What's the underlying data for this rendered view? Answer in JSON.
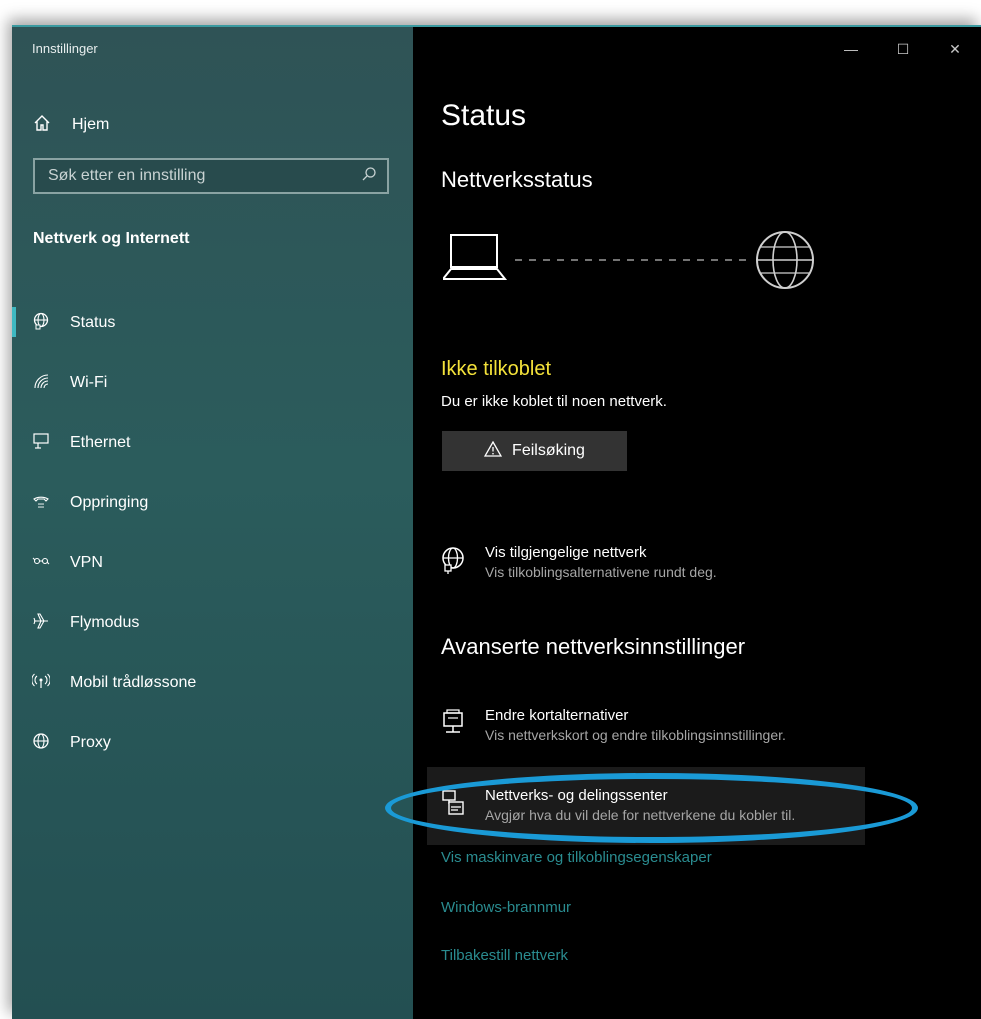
{
  "window": {
    "title": "Innstillinger",
    "caption": {
      "minimize": "—",
      "maximize": "☐",
      "close": "✕"
    }
  },
  "sidebar": {
    "home_label": "Hjem",
    "search_placeholder": "Søk etter en innstilling",
    "section_title": "Nettverk og Internett",
    "items": [
      {
        "label": "Status",
        "icon": "globe-network-icon",
        "active": true
      },
      {
        "label": "Wi-Fi",
        "icon": "wifi-icon"
      },
      {
        "label": "Ethernet",
        "icon": "ethernet-icon"
      },
      {
        "label": "Oppringing",
        "icon": "dialup-icon"
      },
      {
        "label": "VPN",
        "icon": "vpn-icon"
      },
      {
        "label": "Flymodus",
        "icon": "airplane-icon"
      },
      {
        "label": "Mobil trådløssone",
        "icon": "hotspot-icon"
      },
      {
        "label": "Proxy",
        "icon": "globe-icon"
      }
    ]
  },
  "main": {
    "title": "Status",
    "network_status_heading": "Nettverksstatus",
    "status_title": "Ikke tilkoblet",
    "status_text": "Du er ikke koblet til noen nettverk.",
    "troubleshoot_label": "Feilsøking",
    "show_networks": {
      "title": "Vis tilgjengelige nettverk",
      "subtitle": "Vis tilkoblingsalternativene rundt deg."
    },
    "advanced_heading": "Avanserte nettverksinnstillinger",
    "change_adapter": {
      "title": "Endre kortalternativer",
      "subtitle": "Vis nettverkskort og endre tilkoblingsinnstillinger."
    },
    "sharing_center": {
      "title": "Nettverks- og delingssenter",
      "subtitle": "Avgjør hva du vil dele for nettverkene du kobler til."
    },
    "links": {
      "hardware": "Vis maskinvare og tilkoblingsegenskaper",
      "firewall": "Windows-brannmur",
      "reset": "Tilbakestill nettverk"
    }
  },
  "colors": {
    "sidebar_bg": "#2b5c5c",
    "main_bg": "#000000",
    "status_warning": "#f4e23a",
    "link_color": "#2a8c90",
    "accent_bar": "#3fb9c2",
    "annotation_oval": "#1a9ad6"
  }
}
